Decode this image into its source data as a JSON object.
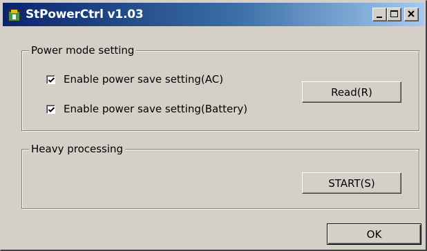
{
  "window": {
    "title": "StPowerCtrl v1.03",
    "icon": "app-icon",
    "controls": [
      "minimize-icon",
      "maximize-icon",
      "close-icon"
    ]
  },
  "power_mode": {
    "legend": "Power mode setting",
    "checkboxes": [
      {
        "label": "Enable power save setting(AC)",
        "checked": true
      },
      {
        "label": "Enable power save setting(Battery)",
        "checked": true
      }
    ],
    "read_button": "Read(R)"
  },
  "heavy_processing": {
    "legend": "Heavy processing",
    "start_button": "START(S)"
  },
  "ok_button": "OK",
  "colors": {
    "face": "#d4d0c8",
    "title_start": "#0a246a",
    "title_end": "#a6caf0"
  }
}
